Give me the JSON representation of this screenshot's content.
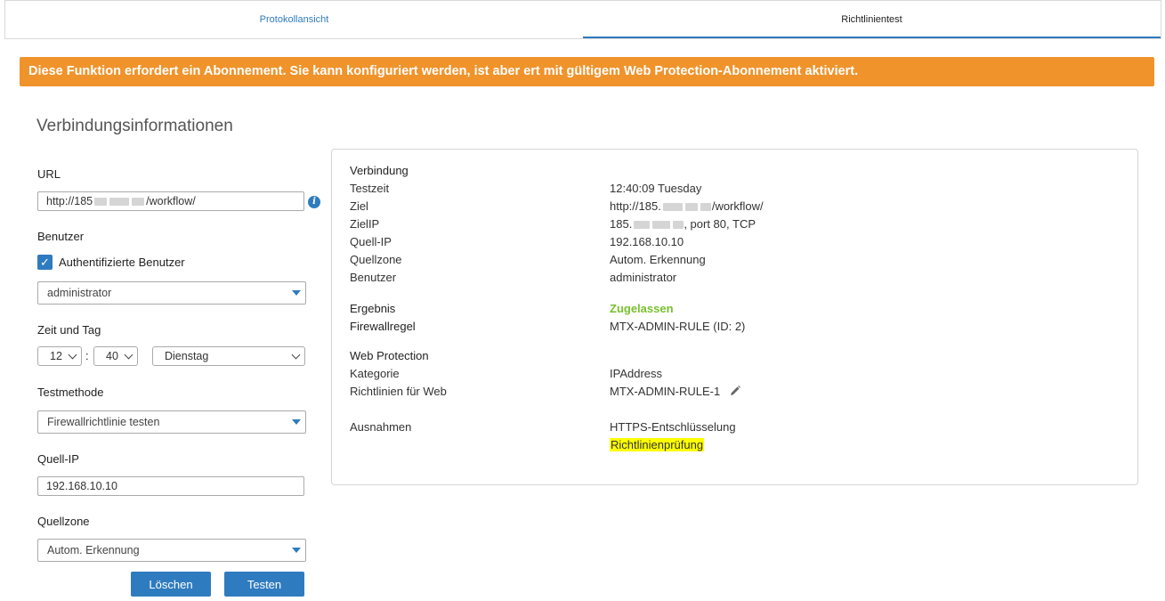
{
  "tabs": [
    {
      "label": "Protokollansicht",
      "active": false
    },
    {
      "label": "Richtlinientest",
      "active": true
    }
  ],
  "banner": "Diese Funktion erfordert ein Abonnement. Sie kann konfiguriert werden, ist aber ert mit gültigem Web Protection-Abonnement aktiviert.",
  "form": {
    "title": "Verbindungsinformationen",
    "url_label": "URL",
    "url_prefix": "http://185",
    "url_suffix": "/workflow/",
    "user_label": "Benutzer",
    "auth_label": "Authentifizierte Benutzer",
    "user_value": "administrator",
    "time_label": "Zeit und Tag",
    "hour": "12",
    "time_sep": ":",
    "minute": "40",
    "day": "Dienstag",
    "method_label": "Testmethode",
    "method_value": "Firewallrichtlinie testen",
    "src_ip_label": "Quell-IP",
    "src_ip_value": "192.168.10.10",
    "src_zone_label": "Quellzone",
    "src_zone_value": "Autom. Erkennung",
    "clear_button": "Löschen",
    "test_button": "Testen"
  },
  "result": {
    "connection_header": "Verbindung",
    "rows": [
      {
        "key": "Testzeit",
        "value": "12:40:09 Tuesday"
      },
      {
        "key": "Ziel",
        "value_prefix": "http://185.",
        "value_suffix": "/workflow/"
      },
      {
        "key": "ZielIP",
        "value_prefix": "185.",
        "value_suffix": ", port 80, TCP"
      },
      {
        "key": "Quell-IP",
        "value": "192.168.10.10"
      },
      {
        "key": "Quellzone",
        "value": "Autom. Erkennung"
      },
      {
        "key": "Benutzer",
        "value": "administrator"
      }
    ],
    "result_label": "Ergebnis",
    "result_value": "Zugelassen",
    "rule_label": "Firewallregel",
    "rule_value": "MTX-ADMIN-RULE (ID: 2)",
    "wp_header": "Web Protection",
    "category_label": "Kategorie",
    "category_value": "IPAddress",
    "web_policy_label": "Richtlinien für Web",
    "web_policy_value": "MTX-ADMIN-RULE-1",
    "exceptions_label": "Ausnahmen",
    "exception_1": "HTTPS-Entschlüsselung",
    "exception_2": "Richtlinienprüfung"
  },
  "colors": {
    "accent": "#2f7bbf",
    "banner": "#f0932b",
    "allowed": "#77c12d",
    "highlight": "#ffff00"
  }
}
